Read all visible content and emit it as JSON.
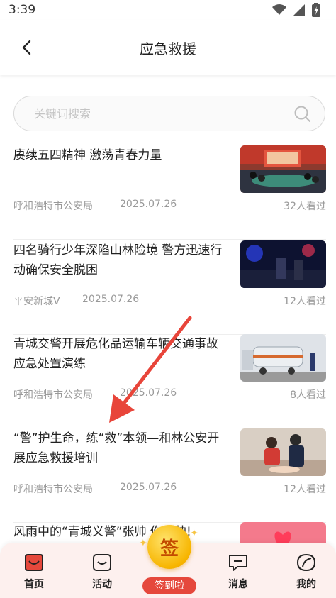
{
  "status": {
    "time": "3:39"
  },
  "header": {
    "title": "应急救援"
  },
  "search": {
    "placeholder": "关键词搜索"
  },
  "articles": [
    {
      "title": "赓续五四精神 激荡青春力量",
      "source": "呼和浩特市公安局",
      "date": "2025.07.26",
      "views": "32人看过",
      "thumb": "meeting-room-photo"
    },
    {
      "title": "四名骑行少年深陷山林险境 警方迅速行动确保安全脱困",
      "source": "平安新城V",
      "date": "2025.07.26",
      "views": "12人看过",
      "thumb": "night-rescue-photo"
    },
    {
      "title": "青城交警开展危化品运输车辆交通事故应急处置演练",
      "source": "呼和浩特市公安局",
      "date": "2025.07.26",
      "views": "8人看过",
      "thumb": "tanker-truck-photo"
    },
    {
      "title": "“警”护生命，练“救”本领—和林公安开展应急救援培训",
      "source": "呼和浩特市公安局",
      "date": "2025.07.26",
      "views": "12人看过",
      "thumb": "cpr-training-photo"
    },
    {
      "title": "风雨中的“青城义警”张帅 你真帅!",
      "thumb": "heart-banner-photo"
    }
  ],
  "tabbar": {
    "home": "首页",
    "activity": "活动",
    "sign_char": "签",
    "sign_label": "签到啦",
    "messages": "消息",
    "mine": "我的"
  },
  "colors": {
    "accent": "#e5483c",
    "coin": "#f7b500",
    "tabbar_bg": "#fdf0ee",
    "arrow": "#e8453a"
  }
}
